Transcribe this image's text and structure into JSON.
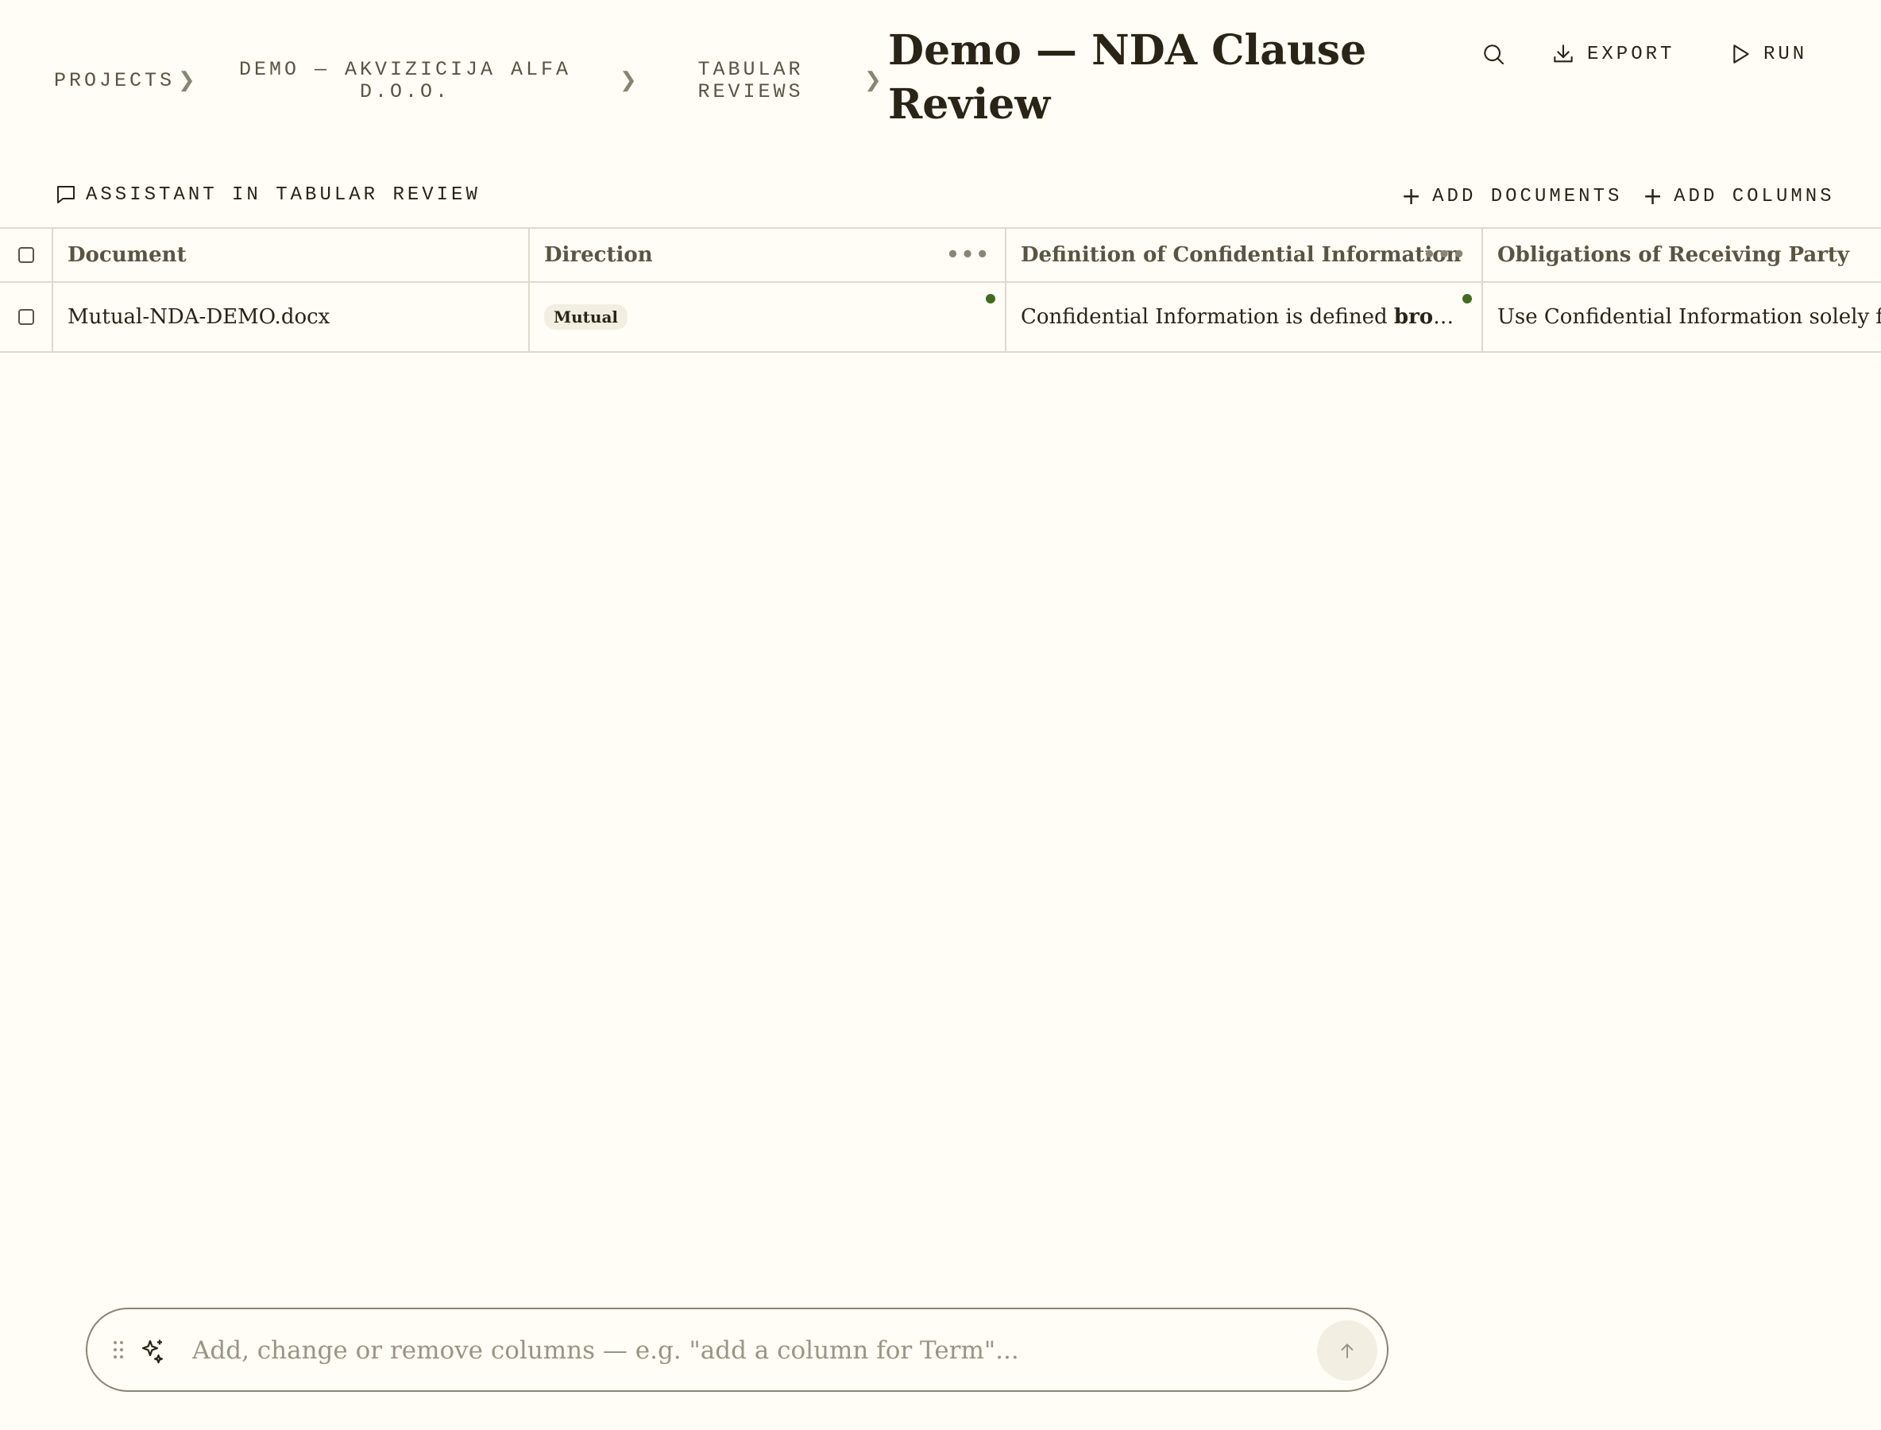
{
  "breadcrumb": {
    "items": [
      {
        "label": "PROJECTS"
      },
      {
        "label": "DEMO — AKVIZICIJA ALFA D.O.O."
      },
      {
        "label": "TABULAR REVIEWS"
      }
    ],
    "current": "Demo — NDA Clause Review"
  },
  "header_actions": {
    "search_icon": "search-icon",
    "export_label": "EXPORT",
    "run_label": "RUN"
  },
  "toolbar": {
    "assistant_label": "ASSISTANT IN TABULAR REVIEW",
    "add_documents_label": "ADD DOCUMENTS",
    "add_columns_label": "ADD COLUMNS"
  },
  "table": {
    "columns": [
      {
        "label": "Document"
      },
      {
        "label": "Direction"
      },
      {
        "label": "Definition of Confidential Information"
      },
      {
        "label": "Obligations of Receiving Party"
      }
    ],
    "rows": [
      {
        "document": "Mutual-NDA-DEMO.docx",
        "direction": "Mutual",
        "definition_prefix": "Confidential Information is defined ",
        "definition_bold": "broadly",
        "definition_suffix": "...",
        "obligations": "Use Confidential Information solely for"
      }
    ]
  },
  "composer": {
    "placeholder": "Add, change or remove columns — e.g. \"add a column for Term\"..."
  },
  "colors": {
    "background": "#fffdf6",
    "text": "#2a2416",
    "status_dot": "#3f6e1a",
    "border": "#ddd9cd"
  }
}
